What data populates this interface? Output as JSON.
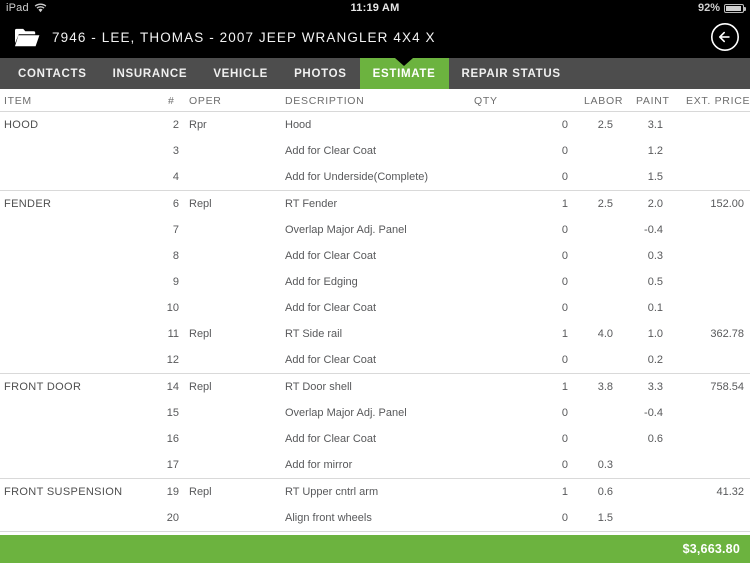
{
  "statusbar": {
    "device": "iPad",
    "wifi_icon": "wifi-icon",
    "time": "11:19 AM",
    "battery_percent": "92%",
    "battery_icon": "battery-icon"
  },
  "titlebar": {
    "folder_icon": "folder-icon",
    "title": "7946 - LEE, THOMAS - 2007 JEEP WRANGLER 4X4 X",
    "back_icon": "back-arrow-icon"
  },
  "tabs": [
    {
      "label": "CONTACTS",
      "active": false
    },
    {
      "label": "INSURANCE",
      "active": false
    },
    {
      "label": "VEHICLE",
      "active": false
    },
    {
      "label": "PHOTOS",
      "active": false
    },
    {
      "label": "ESTIMATE",
      "active": true
    },
    {
      "label": "REPAIR STATUS",
      "active": false
    }
  ],
  "columns": {
    "item": "ITEM",
    "num": "#",
    "oper": "OPER",
    "description": "DESCRIPTION",
    "qty": "QTY",
    "labor": "LABOR",
    "paint": "PAINT",
    "ext_price": "EXT. PRICE $"
  },
  "sections": [
    {
      "item": "HOOD",
      "rows": [
        {
          "num": "2",
          "oper": "Rpr",
          "description": "Hood",
          "qty": "0",
          "labor": "2.5",
          "paint": "3.1",
          "ext_price": ""
        },
        {
          "num": "3",
          "oper": "",
          "description": "Add for Clear Coat",
          "qty": "0",
          "labor": "",
          "paint": "1.2",
          "ext_price": ""
        },
        {
          "num": "4",
          "oper": "",
          "description": "Add for Underside(Complete)",
          "qty": "0",
          "labor": "",
          "paint": "1.5",
          "ext_price": ""
        }
      ]
    },
    {
      "item": "FENDER",
      "rows": [
        {
          "num": "6",
          "oper": "Repl",
          "description": "RT Fender",
          "qty": "1",
          "labor": "2.5",
          "paint": "2.0",
          "ext_price": "152.00"
        },
        {
          "num": "7",
          "oper": "",
          "description": "Overlap Major Adj. Panel",
          "qty": "0",
          "labor": "",
          "paint": "-0.4",
          "ext_price": ""
        },
        {
          "num": "8",
          "oper": "",
          "description": "Add for Clear Coat",
          "qty": "0",
          "labor": "",
          "paint": "0.3",
          "ext_price": ""
        },
        {
          "num": "9",
          "oper": "",
          "description": "Add for Edging",
          "qty": "0",
          "labor": "",
          "paint": "0.5",
          "ext_price": ""
        },
        {
          "num": "10",
          "oper": "",
          "description": "Add for Clear Coat",
          "qty": "0",
          "labor": "",
          "paint": "0.1",
          "ext_price": ""
        },
        {
          "num": "11",
          "oper": "Repl",
          "description": "RT Side rail",
          "qty": "1",
          "labor": "4.0",
          "paint": "1.0",
          "ext_price": "362.78"
        },
        {
          "num": "12",
          "oper": "",
          "description": "Add for Clear Coat",
          "qty": "0",
          "labor": "",
          "paint": "0.2",
          "ext_price": ""
        }
      ]
    },
    {
      "item": "FRONT DOOR",
      "rows": [
        {
          "num": "14",
          "oper": "Repl",
          "description": "RT Door shell",
          "qty": "1",
          "labor": "3.8",
          "paint": "3.3",
          "ext_price": "758.54"
        },
        {
          "num": "15",
          "oper": "",
          "description": "Overlap Major Adj. Panel",
          "qty": "0",
          "labor": "",
          "paint": "-0.4",
          "ext_price": ""
        },
        {
          "num": "16",
          "oper": "",
          "description": "Add for Clear Coat",
          "qty": "0",
          "labor": "",
          "paint": "0.6",
          "ext_price": ""
        },
        {
          "num": "17",
          "oper": "",
          "description": "Add for mirror",
          "qty": "0",
          "labor": "0.3",
          "paint": "",
          "ext_price": ""
        }
      ]
    },
    {
      "item": "FRONT SUSPENSION",
      "rows": [
        {
          "num": "19",
          "oper": "Repl",
          "description": "RT Upper cntrl arm",
          "qty": "1",
          "labor": "0.6",
          "paint": "",
          "ext_price": "41.32"
        },
        {
          "num": "20",
          "oper": "",
          "description": "Align front wheels",
          "qty": "0",
          "labor": "1.5",
          "paint": "",
          "ext_price": ""
        }
      ]
    }
  ],
  "footer": {
    "total": "$3,663.80"
  },
  "colors": {
    "accent_green": "#6cb33f",
    "tabbar_gray": "#4d4d4d",
    "titlebar_black": "#000000",
    "text_gray": "#58595b"
  }
}
